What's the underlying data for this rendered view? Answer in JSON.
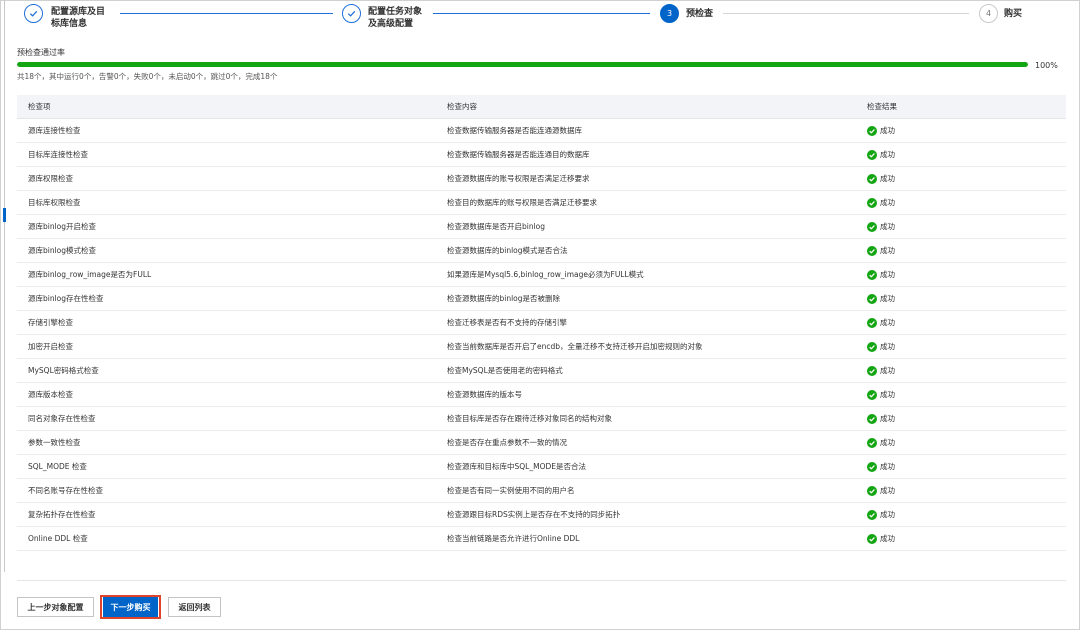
{
  "steps": [
    {
      "index": "",
      "label_line1": "配置源库及目",
      "label_line2": "标库信息",
      "state": "done"
    },
    {
      "index": "",
      "label_line1": "配置任务对象",
      "label_line2": "及高级配置",
      "state": "done"
    },
    {
      "index": "3",
      "label_line1": "预检查",
      "label_line2": "",
      "state": "active"
    },
    {
      "index": "4",
      "label_line1": "购买",
      "label_line2": "",
      "state": "todo"
    }
  ],
  "progress": {
    "title": "预检查通过率",
    "value": 100,
    "value_label": "100%",
    "summary": "共18个，其中运行0个，告警0个，失败0个，未启动0个，跳过0个，完成18个"
  },
  "table": {
    "headers": [
      "检查项",
      "检查内容",
      "检查结果"
    ],
    "rows": [
      {
        "item": "源库连接性检查",
        "content": "检查数据传输服务器是否能连通源数据库",
        "result": "成功"
      },
      {
        "item": "目标库连接性检查",
        "content": "检查数据传输服务器是否能连通目的数据库",
        "result": "成功"
      },
      {
        "item": "源库权限检查",
        "content": "检查源数据库的账号权限是否满足迁移要求",
        "result": "成功"
      },
      {
        "item": "目标库权限检查",
        "content": "检查目的数据库的账号权限是否满足迁移要求",
        "result": "成功"
      },
      {
        "item": "源库binlog开启检查",
        "content": "检查源数据库是否开启binlog",
        "result": "成功"
      },
      {
        "item": "源库binlog模式检查",
        "content": "检查源数据库的binlog模式是否合法",
        "result": "成功"
      },
      {
        "item": "源库binlog_row_image是否为FULL",
        "content": "如果源库是Mysql5.6,binlog_row_image必须为FULL模式",
        "result": "成功"
      },
      {
        "item": "源库binlog存在性检查",
        "content": "检查源数据库的binlog是否被删除",
        "result": "成功"
      },
      {
        "item": "存储引擎检查",
        "content": "检查迁移表是否有不支持的存储引擎",
        "result": "成功"
      },
      {
        "item": "加密开启检查",
        "content": "检查当前数据库是否开启了encdb，全量迁移不支持迁移开启加密规则的对象",
        "result": "成功"
      },
      {
        "item": "MySQL密码格式检查",
        "content": "检查MySQL是否使用老的密码格式",
        "result": "成功"
      },
      {
        "item": "源库版本检查",
        "content": "检查源数据库的版本号",
        "result": "成功"
      },
      {
        "item": "同名对象存在性检查",
        "content": "检查目标库是否存在跟待迁移对象同名的结构对象",
        "result": "成功"
      },
      {
        "item": "参数一致性检查",
        "content": "检查是否存在重点参数不一致的情况",
        "result": "成功"
      },
      {
        "item": "SQL_MODE 检查",
        "content": "检查源库和目标库中SQL_MODE是否合法",
        "result": "成功"
      },
      {
        "item": "不同名账号存在性检查",
        "content": "检查是否有同一实例使用不同的用户名",
        "result": "成功"
      },
      {
        "item": "复杂拓扑存在性检查",
        "content": "检查源跟目标RDS实例上是否存在不支持的同步拓扑",
        "result": "成功"
      },
      {
        "item": "Online DDL 检查",
        "content": "检查当前链路是否允许进行Online DDL",
        "result": "成功"
      }
    ]
  },
  "footer": {
    "prev_label": "上一步对象配置",
    "next_label": "下一步购买",
    "back_label": "返回列表"
  },
  "colors": {
    "primary": "#0064c8",
    "success": "#13a513",
    "highlight": "#e0432b"
  },
  "icons": {
    "step_done": "check-icon",
    "result_ok": "success-check-icon"
  }
}
